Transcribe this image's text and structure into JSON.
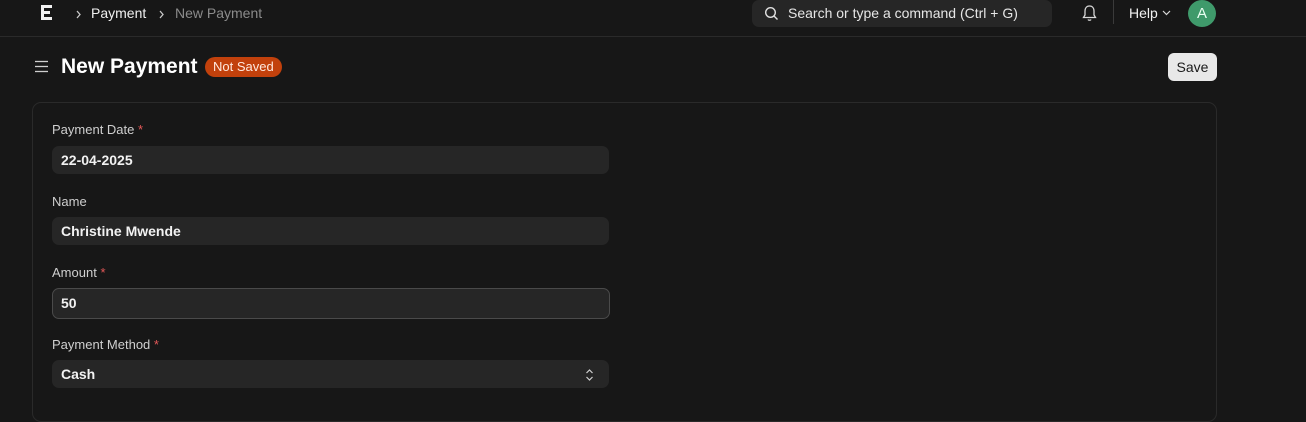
{
  "navbar": {
    "breadcrumbs": [
      "Payment",
      "New Payment"
    ],
    "search_placeholder": "Search or type a command (Ctrl + G)",
    "help_label": "Help",
    "avatar_initial": "A"
  },
  "page": {
    "title": "New Payment",
    "status": "Not Saved",
    "save_label": "Save"
  },
  "form": {
    "fields": [
      {
        "label": "Payment Date",
        "required": true,
        "value": "22-04-2025"
      },
      {
        "label": "Name",
        "required": false,
        "value": "Christine Mwende"
      },
      {
        "label": "Amount",
        "required": true,
        "value": "50"
      },
      {
        "label": "Payment Method",
        "required": true,
        "value": "Cash"
      }
    ]
  },
  "colors": {
    "background": "#171717",
    "input_bg": "#262626",
    "badge": "#c2410c",
    "avatar": "#3f9a6b",
    "required": "#e45858"
  }
}
